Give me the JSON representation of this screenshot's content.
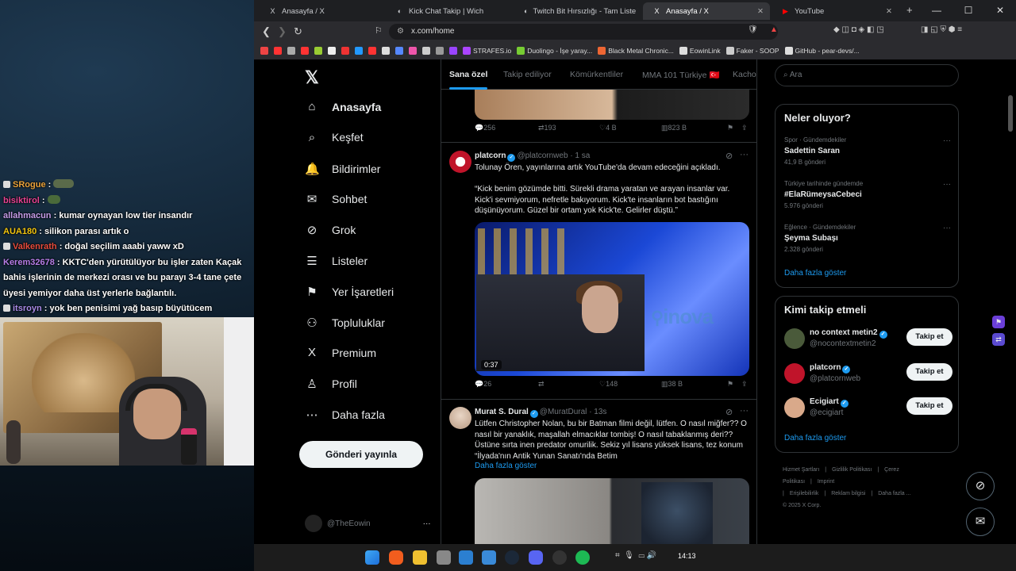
{
  "chat": [
    {
      "user": "SRogue",
      "color": "#e9a23b",
      "msg": "",
      "emote": true
    },
    {
      "user": "bisiktirol",
      "color": "#e84393",
      "msg": "",
      "emote_small": true
    },
    {
      "user": "allahmacun",
      "color": "#c59ce8",
      "msg": "kumar oynayan low tier insandır"
    },
    {
      "user": "AUA180",
      "color": "#f1c40f",
      "msg": "silikon parası artık o"
    },
    {
      "user": "Valkenrath",
      "color": "#e74c3c",
      "msg": "doğal seçilim aaabi yaww xD"
    },
    {
      "user": "Kerem32678",
      "color": "#b77ee8",
      "msg": "KKTC'den yürütülüyor bu işler zaten Kaçak bahis işlerinin de merkezi orası ve bu parayı 3-4 tane çete üyesi yemiyor daha üst yerlerle bağlantılı."
    },
    {
      "user": "itsroyn",
      "color": "#a98be8",
      "msg": "yok ben penisimi yağ basıp büyütücem"
    }
  ],
  "browser": {
    "tabs": [
      {
        "label": "Anasayfa / X",
        "icon": "X"
      },
      {
        "label": "Kick Chat Takip | Wich",
        "icon": "◐"
      },
      {
        "label": "Twitch Bit Hırsızlığı - Tam Liste Yayın",
        "icon": "◐"
      },
      {
        "label": "Anasayfa / X",
        "icon": "X"
      },
      {
        "label": "YouTube",
        "icon": "▶"
      }
    ],
    "url": "x.com/home",
    "bookmarks": [
      {
        "label": "",
        "color": "#e44"
      },
      {
        "label": "",
        "color": "#f33"
      },
      {
        "label": "",
        "color": "#aaa"
      },
      {
        "label": "",
        "color": "#f33"
      },
      {
        "label": "",
        "color": "#9c3"
      },
      {
        "label": "",
        "color": "#eee"
      },
      {
        "label": "",
        "color": "#e33"
      },
      {
        "label": "",
        "color": "#29f"
      },
      {
        "label": "",
        "color": "#f33"
      },
      {
        "label": "",
        "color": "#ddd"
      },
      {
        "label": "",
        "color": "#58f"
      },
      {
        "label": "",
        "color": "#e5a"
      },
      {
        "label": "",
        "color": "#ccc"
      },
      {
        "label": "",
        "color": "#999"
      },
      {
        "label": "",
        "color": "#94f"
      },
      {
        "label": "STRAFES.io",
        "color": "#a4f"
      },
      {
        "label": "Duolingo - İşe yaray...",
        "color": "#7c3"
      },
      {
        "label": "Black Metal Chronic...",
        "color": "#e63"
      },
      {
        "label": "EowinLink",
        "color": "#ddd"
      },
      {
        "label": "Faker - SOOP",
        "color": "#ccc"
      },
      {
        "label": "GitHub - pear-devs/...",
        "color": "#ddd"
      }
    ]
  },
  "x": {
    "nav": [
      {
        "label": "Anasayfa",
        "icon": "⌂",
        "bold": true
      },
      {
        "label": "Keşfet",
        "icon": "⌕"
      },
      {
        "label": "Bildirimler",
        "icon": "🔔"
      },
      {
        "label": "Sohbet",
        "icon": "✉"
      },
      {
        "label": "Grok",
        "icon": "⊘"
      },
      {
        "label": "Listeler",
        "icon": "☰"
      },
      {
        "label": "Yer İşaretleri",
        "icon": "⚑"
      },
      {
        "label": "Topluluklar",
        "icon": "⚇"
      },
      {
        "label": "Premium",
        "icon": "X"
      },
      {
        "label": "Profil",
        "icon": "♙"
      },
      {
        "label": "Daha fazla",
        "icon": "⋯"
      }
    ],
    "post_button": "Gönderi yayınla",
    "account_handle": "@TheEowin",
    "feed_tabs": [
      "Sana özel",
      "Takip ediliyor",
      "Kömürkentliler",
      "MMA 101 Türkiye",
      "Kacho"
    ],
    "feed_tab_flag": "🇹🇷",
    "post0_actions": {
      "replies": "256",
      "reposts": "193",
      "likes": "4 B",
      "views": "823 B"
    },
    "post1": {
      "name": "platcorn",
      "handle": "@platcornweb",
      "time": "· 1 sa",
      "text1": "Tolunay Ören, yayınlarına artık YouTube'da devam edeceğini açıkladı.",
      "text2": "“Kick benim gözümde bitti. Sürekli drama yaratan ve arayan insanlar var. Kick'i sevmiyorum, nefretle bakıyorum. Kick'te insanların bot bastığını düşünüyorum. Güzel bir ortam yok Kick'te. Gelirler düştü.”",
      "video_duration": "0:37",
      "replies": "26",
      "reposts": "",
      "likes": "148",
      "views": "38 B"
    },
    "post2": {
      "name": "Murat S. Dural",
      "handle": "@MuratDural",
      "time": "· 13s",
      "text": "Lütfen Christopher Nolan, bu bir Batman filmi değil, lütfen. O nasıl miğfer?? O nasıl bir yanaklık, maşallah elmacıklar tombiş! O nasıl tabaklanmış deri?? Üstüne sırta inen predator omurilik. Sekiz yıl lisans yüksek lisans, tez konum “İlyada'nın Antik Yunan Sanatı'nda Betim",
      "show_more": "Daha fazla göster"
    },
    "search_placeholder": "Ara",
    "trends_title": "Neler oluyor?",
    "trends": [
      {
        "category": "Spor · Gündemdekiler",
        "name": "Sadettin Saran",
        "count": "41,9 B gönderi"
      },
      {
        "category": "Türkiye tarihinde gündemde",
        "name": "#ElaRümeysaCebeci",
        "count": "5.976 gönderi"
      },
      {
        "category": "Eğlence · Gündemdekiler",
        "name": "Şeyma Subaşı",
        "count": "2.328 gönderi"
      }
    ],
    "trends_more": "Daha fazla göster",
    "who_title": "Kimi takip etmeli",
    "who": [
      {
        "name": "no context metin2",
        "handle": "@nocontextmetin2",
        "button": "Takip et",
        "color": "#4a5a3a"
      },
      {
        "name": "platcorn",
        "handle": "@platcornweb",
        "button": "Takip et",
        "color": "#c0142a"
      },
      {
        "name": "Ecigiart",
        "handle": "@ecigiart",
        "button": "Takip et",
        "color": "#d9a98a"
      }
    ],
    "who_more": "Daha fazla göster",
    "footer": [
      "Hizmet Şartları",
      "|",
      "Gizlilik Politikası",
      "|",
      "Çerez Politikası",
      "|",
      "Imprint",
      "|",
      "Erişilebilirlik",
      "|",
      "Reklam bilgisi",
      "|",
      "Daha fazla ...",
      "© 2025 X Corp."
    ]
  },
  "overlay_logo": "inova",
  "taskbar": {
    "time": "14:13"
  }
}
